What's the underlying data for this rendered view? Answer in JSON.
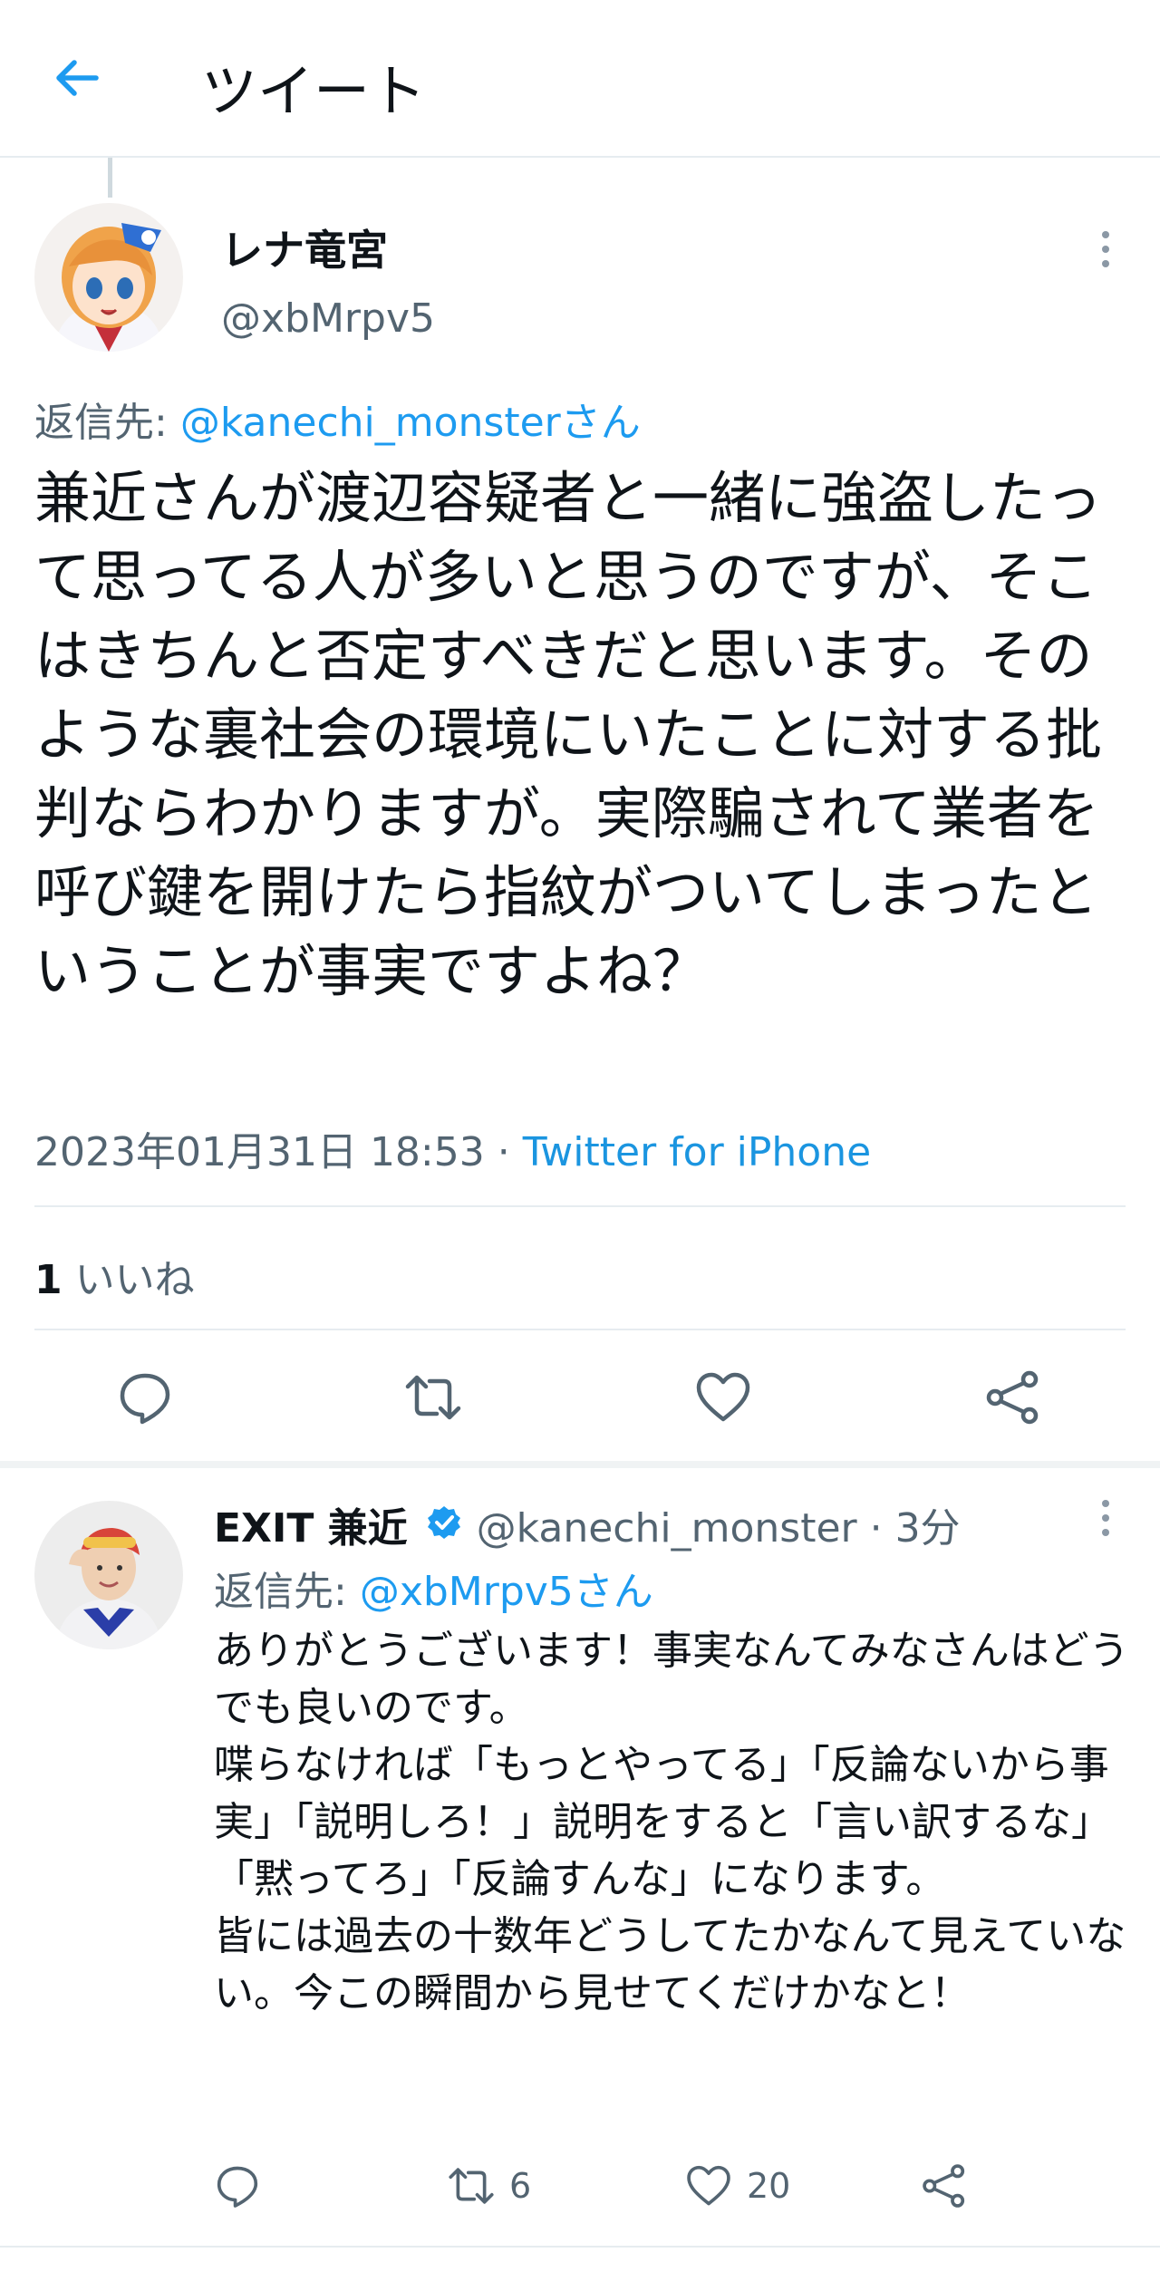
{
  "header": {
    "title": "ツイート"
  },
  "tweet": {
    "display_name": "レナ竜宮",
    "handle": "@xbMrpv5",
    "reply_prefix": "返信先: ",
    "reply_target": "@kanechi_monsterさん",
    "text": "兼近さんが渡辺容疑者と一緒に強盗したって思ってる人が多いと思うのですが、そこはきちんと否定すべきだと思います。そのような裏社会の環境にいたことに対する批判ならわかりますが。実際騙されて業者を呼び鍵を開けたら指紋がついてしまったということが事実ですよね？",
    "timestamp": "2023年01月31日 18:53 · ",
    "source": "Twitter for iPhone",
    "likes_count": "1",
    "likes_label": " いいね"
  },
  "reply": {
    "display_name": "EXIT 兼近",
    "handle_time": " @kanechi_monster · 3分",
    "reply_prefix": "返信先: ",
    "reply_target": "@xbMrpv5さん",
    "text": "ありがとうございます！事実なんてみなさんはどうでも良いのです。\n喋らなければ「もっとやってる」「反論ないから事実」「説明しろ！」説明をすると「言い訳するな」「黙ってろ」「反論すんな」になります。\n皆には過去の十数年どうしてたかなんて見えていない。今この瞬間から見せてくだけかなと！",
    "retweets": "6",
    "likes": "20"
  },
  "colors": {
    "accent": "#1d9bf0",
    "muted": "#536471",
    "verified": "#1d9bf0"
  }
}
